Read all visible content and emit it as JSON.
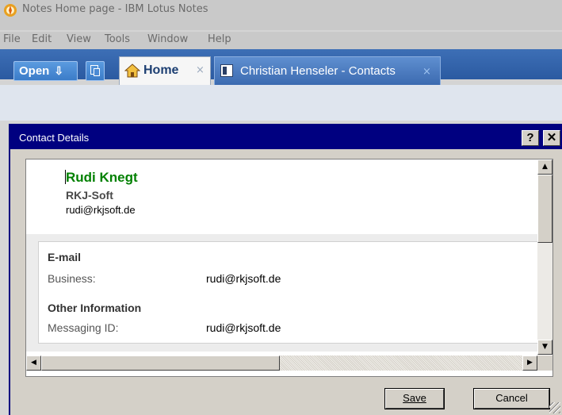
{
  "window": {
    "title": "Notes Home page - IBM Lotus Notes"
  },
  "menu": [
    "File",
    "Edit",
    "View",
    "Tools",
    "Window",
    "Help"
  ],
  "tabs": {
    "open_label": "Open",
    "home_label": "Home",
    "contacts_label": "Christian Henseler - Contacts",
    "close_glyph": "×"
  },
  "dialog": {
    "title": "Contact Details",
    "help_glyph": "?",
    "close_glyph": "✕",
    "contact": {
      "name": "Rudi Knegt",
      "company": "RKJ-Soft",
      "email": "rudi@rkjsoft.de"
    },
    "sections": {
      "email": {
        "heading": "E-mail",
        "business_label": "Business:",
        "business_value": "rudi@rkjsoft.de"
      },
      "other": {
        "heading": "Other Information",
        "messaging_label": "Messaging ID:",
        "messaging_value": "rudi@rkjsoft.de"
      }
    },
    "buttons": {
      "save": "Save",
      "cancel": "Cancel"
    }
  },
  "colors": {
    "name_green": "#008000",
    "dialog_title_bg": "#000080",
    "tab_bar_blue": "#3d6fb6"
  }
}
